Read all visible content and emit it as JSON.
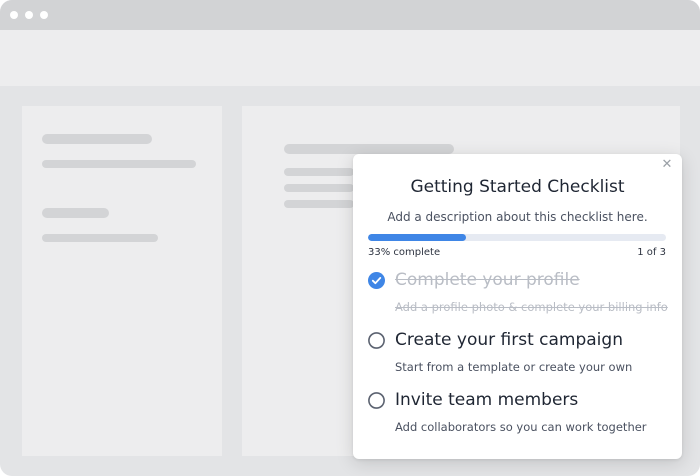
{
  "popup": {
    "close_glyph": "✕",
    "title": "Getting Started Checklist",
    "description": "Add a description about this checklist here.",
    "progress": {
      "percent": 33,
      "label": "33% complete",
      "count": "1 of 3"
    },
    "items": [
      {
        "title": "Complete your profile",
        "subtitle": "Add a profile photo & complete your billing info",
        "completed": true
      },
      {
        "title": "Create your first campaign",
        "subtitle": "Start from a template or create your own",
        "completed": false
      },
      {
        "title": "Invite team members",
        "subtitle": "Add collaborators so you can work together",
        "completed": false
      }
    ]
  },
  "colors": {
    "accent": "#3f86e6",
    "completed_text": "#b9bdc5",
    "text": "#1f2633"
  }
}
